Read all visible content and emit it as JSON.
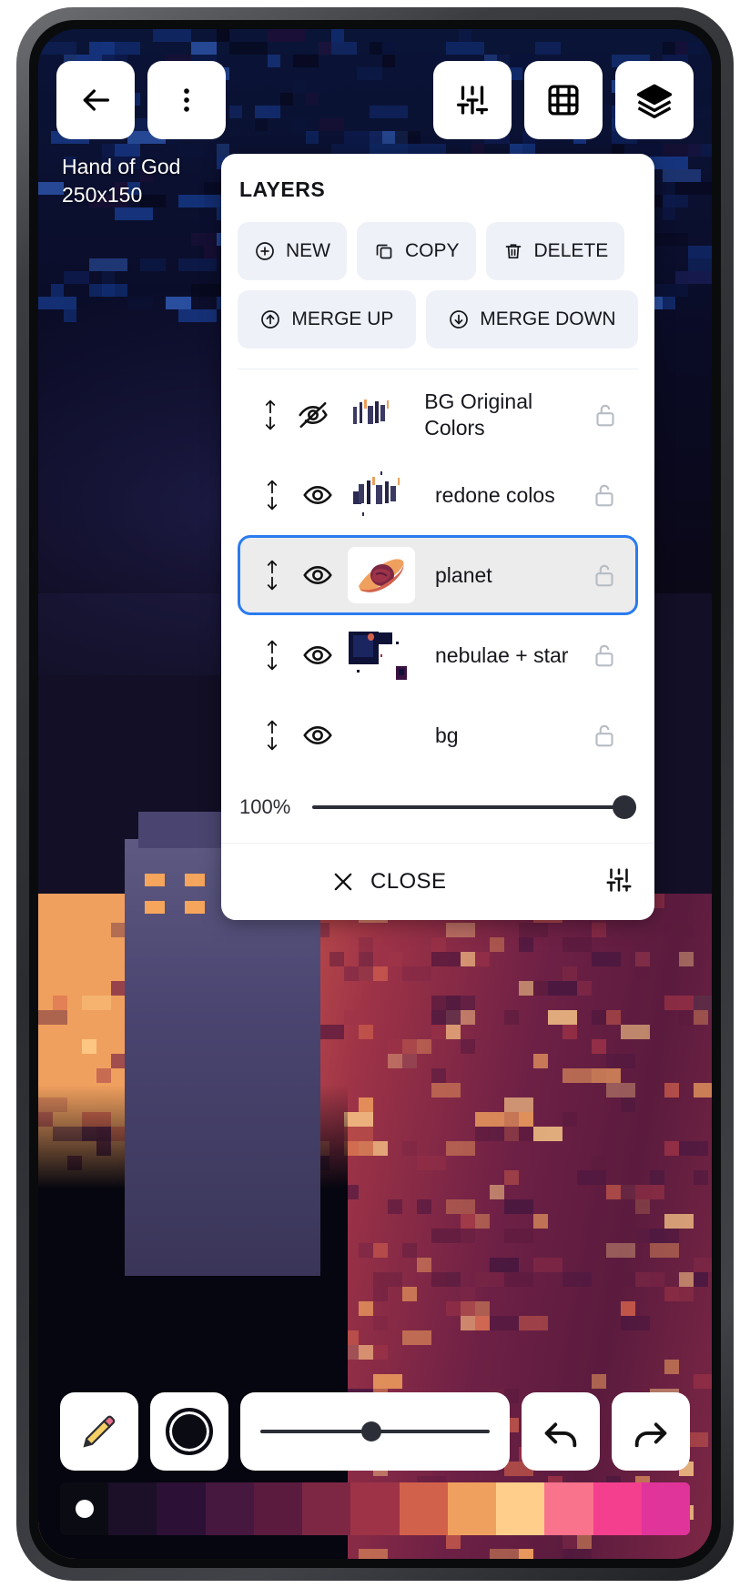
{
  "artwork": {
    "title": "Hand of God",
    "dimensions": "250x150"
  },
  "top_toolbar": {
    "buttons": [
      {
        "name": "back-button",
        "icon": "arrow-left-icon"
      },
      {
        "name": "more-menu-button",
        "icon": "more-vertical-icon"
      },
      {
        "name": "adjustments-button",
        "icon": "sliders-icon"
      },
      {
        "name": "frames-button",
        "icon": "film-strip-icon"
      },
      {
        "name": "layers-button",
        "icon": "layers-stack-icon"
      }
    ]
  },
  "layers_panel": {
    "title": "LAYERS",
    "actions": [
      {
        "label": "NEW",
        "icon": "plus-circle-icon"
      },
      {
        "label": "COPY",
        "icon": "copy-icon"
      },
      {
        "label": "DELETE",
        "icon": "trash-icon"
      },
      {
        "label": "MERGE UP",
        "icon": "arrow-up-circle-icon"
      },
      {
        "label": "MERGE DOWN",
        "icon": "arrow-down-circle-icon"
      }
    ],
    "layers": [
      {
        "name": "BG Original Colors",
        "visible": false,
        "locked": false,
        "selected": false,
        "has_thumbnail": true
      },
      {
        "name": "redone colos",
        "visible": true,
        "locked": false,
        "selected": false,
        "has_thumbnail": true
      },
      {
        "name": "planet",
        "visible": true,
        "locked": false,
        "selected": true,
        "has_thumbnail": true
      },
      {
        "name": "nebulae + star",
        "visible": true,
        "locked": false,
        "selected": false,
        "has_thumbnail": true
      },
      {
        "name": "bg",
        "visible": true,
        "locked": false,
        "selected": false,
        "has_thumbnail": false
      }
    ],
    "opacity": {
      "value_label": "100%",
      "value": 100
    },
    "footer": {
      "close_label": "CLOSE",
      "close_icon": "x-icon",
      "settings_icon": "sliders-icon"
    }
  },
  "bottom_toolbar": {
    "buttons": [
      {
        "name": "pencil-tool-button",
        "icon": "pencil-icon"
      },
      {
        "name": "color-picker-button",
        "icon": "color-swatch-icon"
      },
      {
        "name": "brush-size-slider",
        "icon": "slider-icon"
      },
      {
        "name": "undo-button",
        "icon": "undo-arrow-icon"
      },
      {
        "name": "redo-button",
        "icon": "redo-arrow-icon"
      }
    ],
    "brush_size_percent": 44,
    "current_color": "#0b0b14"
  },
  "palette": {
    "swatches": [
      "#0b0b14",
      "#1c0f28",
      "#2d1036",
      "#46173f",
      "#5b1b3e",
      "#7d2745",
      "#9e3347",
      "#d2614c",
      "#f0a05e",
      "#ffce8a",
      "#f9738c",
      "#f43f8e",
      "#e0349a"
    ],
    "active_index": 0
  },
  "theme": {
    "accent": "#2a7bf0",
    "panel_bg": "#ffffff",
    "button_bg": "#eef1f7",
    "selected_row_bg": "#ececec",
    "text": "#15171c",
    "muted": "#9aa0a8"
  }
}
